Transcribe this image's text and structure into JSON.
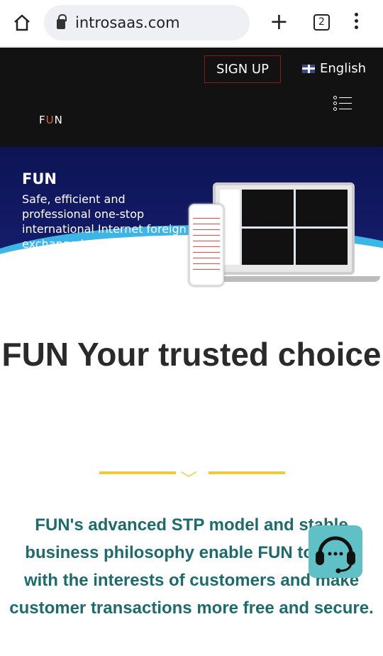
{
  "browser": {
    "url": "introsaas.com",
    "tab_count": "2"
  },
  "header": {
    "signup_label": "SIGN UP",
    "language": "English",
    "logo_f": "F",
    "logo_u": "U",
    "logo_n": "N"
  },
  "banner": {
    "title": "FUN",
    "subtitle": "Safe, efficient and professional one-stop international Internet foreign exchange brokerage"
  },
  "main": {
    "heading": "FUN Your trusted choice",
    "description": "FUN's advanced STP model and stable business philosophy enable FUN to align with the interests of customers and make customer transactions more free and secure."
  },
  "colors": {
    "accent_logo": "#e0633a",
    "divider": "#f0c93a",
    "text_teal": "#1d6b6d",
    "support_bg": "#5fc1c6"
  }
}
